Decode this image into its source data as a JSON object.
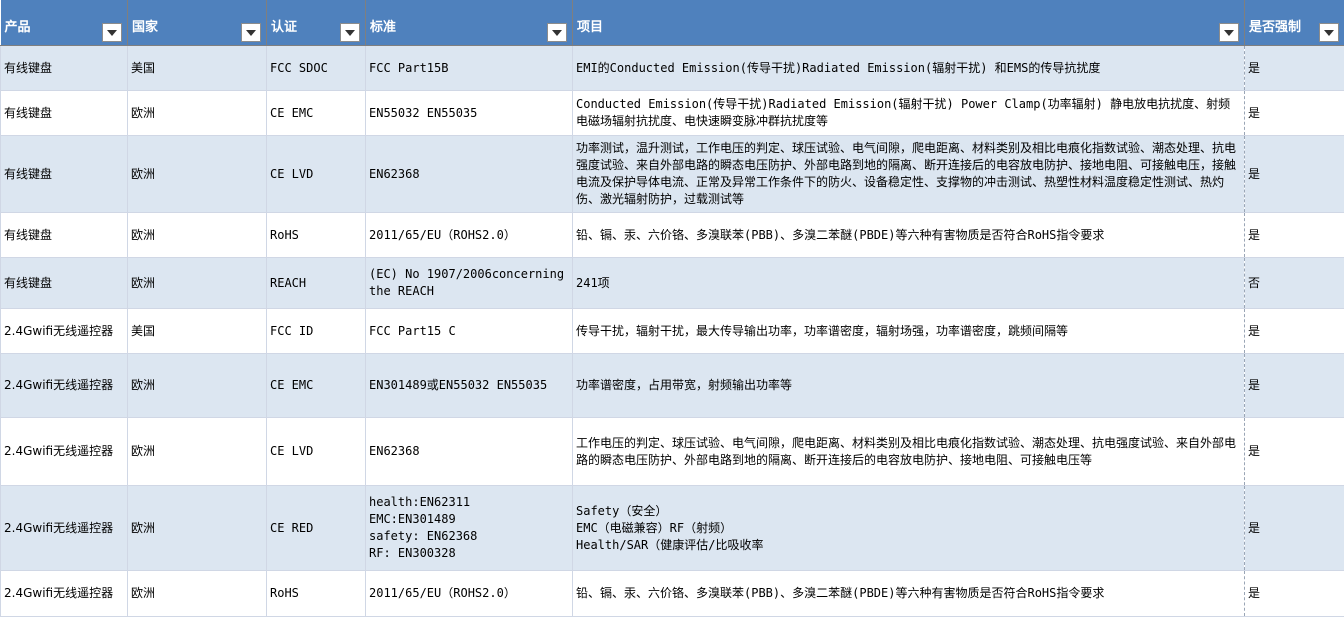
{
  "headers": [
    "产品",
    "国家",
    "认证",
    "标准",
    "项目",
    "是否强制"
  ],
  "rows": [
    {
      "product": "有线键盘",
      "country": "美国",
      "cert": "FCC SDOC",
      "standard": "FCC Part15B",
      "items": "EMI的Conducted Emission(传导干扰)Radiated Emission(辐射干扰) 和EMS的传导抗扰度",
      "mandatory": "是"
    },
    {
      "product": "有线键盘",
      "country": "欧洲",
      "cert": "CE EMC",
      "standard": "EN55032 EN55035",
      "items": "Conducted Emission(传导干扰)Radiated Emission(辐射干扰) Power Clamp(功率辐射) 静电放电抗扰度、射频电磁场辐射抗扰度、电快速瞬变脉冲群抗扰度等",
      "mandatory": "是"
    },
    {
      "product": "有线键盘",
      "country": "欧洲",
      "cert": "CE LVD",
      "standard": "EN62368",
      "items": "功率测试，温升测试，工作电压的判定、球压试验、电气间隙，爬电距离、材料类别及相比电痕化指数试验、潮态处理、抗电强度试验、来自外部电路的瞬态电压防护、外部电路到地的隔离、断开连接后的电容放电防护、接地电阻、可接触电压，接触电流及保护导体电流、正常及异常工作条件下的防火、设备稳定性、支撑物的冲击测试、热塑性材料温度稳定性测试、热灼伤、激光辐射防护，过载测试等",
      "mandatory": "是"
    },
    {
      "product": "有线键盘",
      "country": "欧洲",
      "cert": "RoHS",
      "standard": "2011/65/EU（ROHS2.0）",
      "items": "铅、镉、汞、六价铬、多溴联苯(PBB)、多溴二苯醚(PBDE)等六种有害物质是否符合RoHS指令要求",
      "mandatory": "是"
    },
    {
      "product": "有线键盘",
      "country": "欧洲",
      "cert": "REACH",
      "standard": "(EC) No 1907/2006concerning the REACH",
      "items": "241项",
      "mandatory": "否"
    },
    {
      "product": "2.4Gwifi无线遥控器",
      "country": "美国",
      "cert": "FCC ID",
      "standard": "FCC Part15 C",
      "items": "传导干扰，辐射干扰，最大传导输出功率，功率谱密度，辐射场强，功率谱密度，跳频间隔等",
      "mandatory": "是"
    },
    {
      "product": "2.4Gwifi无线遥控器",
      "country": "欧洲",
      "cert": "CE EMC",
      "standard": "EN301489或EN55032 EN55035",
      "items": "功率谱密度，占用带宽，射频输出功率等",
      "mandatory": "是"
    },
    {
      "product": "2.4Gwifi无线遥控器",
      "country": "欧洲",
      "cert": "CE LVD",
      "standard": "EN62368",
      "items": "工作电压的判定、球压试验、电气间隙，爬电距离、材料类别及相比电痕化指数试验、潮态处理、抗电强度试验、来自外部电路的瞬态电压防护、外部电路到地的隔离、断开连接后的电容放电防护、接地电阻、可接触电压等",
      "mandatory": "是"
    },
    {
      "product": "2.4Gwifi无线遥控器",
      "country": "欧洲",
      "cert": "CE RED",
      "standard": "health:EN62311\nEMC:EN301489\nsafety: EN62368\nRF: EN300328",
      "items": "Safety（安全）\nEMC（电磁兼容）RF（射频）\nHealth/SAR（健康评估/比吸收率",
      "mandatory": "是"
    },
    {
      "product": "2.4Gwifi无线遥控器",
      "country": "欧洲",
      "cert": "RoHS",
      "standard": "2011/65/EU（ROHS2.0）",
      "items": "铅、镉、汞、六价铬、多溴联苯(PBB)、多溴二苯醚(PBDE)等六种有害物质是否符合RoHS指令要求",
      "mandatory": "是"
    }
  ]
}
